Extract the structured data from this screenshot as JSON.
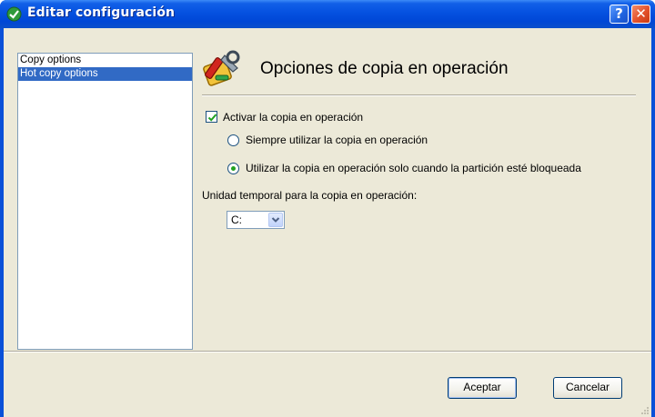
{
  "window": {
    "title": "Editar configuración",
    "help_label": "?",
    "close_label": "✕"
  },
  "nav": {
    "items": [
      {
        "label": "Copy options"
      },
      {
        "label": "Hot copy options"
      }
    ],
    "selected_index": 1
  },
  "content": {
    "heading": "Opciones de copia en operación",
    "heading_icon": "tools-icon",
    "enable_checkbox": {
      "label": "Activar la copia en operación",
      "checked": true
    },
    "radios": [
      {
        "label": "Siempre utilizar la copia en operación",
        "selected": false
      },
      {
        "label": "Utilizar la copia en operación solo cuando la partición esté bloqueada",
        "selected": true
      }
    ],
    "temp_drive": {
      "label": "Unidad temporal para la copia en operación:",
      "value": "C:"
    }
  },
  "buttons": {
    "ok_label": "Aceptar",
    "cancel_label": "Cancelar"
  },
  "colors": {
    "titlebar": "#0551e0",
    "selection": "#316ac5",
    "face": "#ece9d8"
  }
}
